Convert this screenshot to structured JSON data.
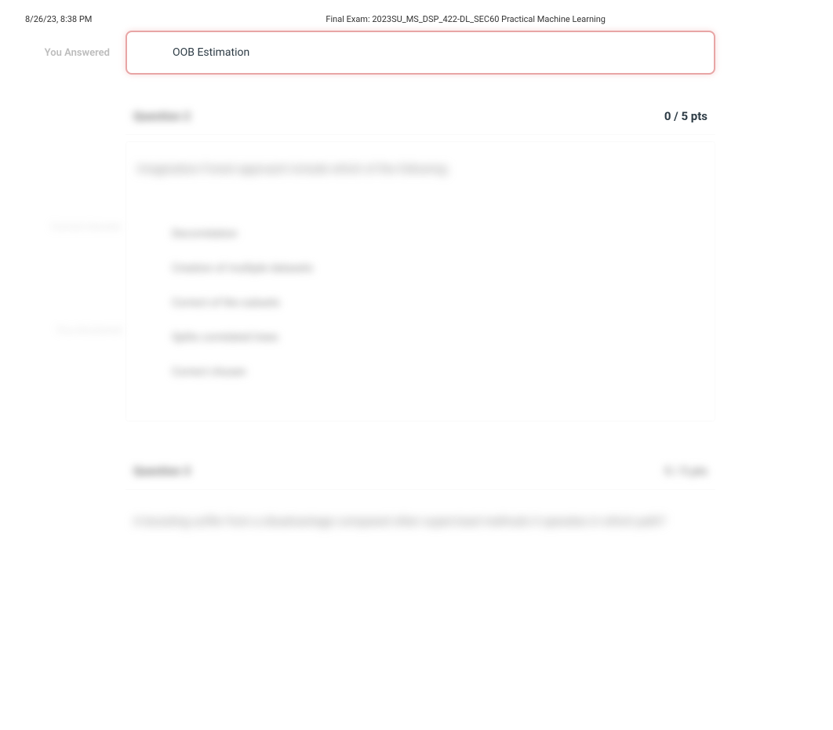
{
  "header": {
    "timestamp": "8/26/23, 8:38 PM",
    "title": "Final Exam: 2023SU_MS_DSP_422-DL_SEC60 Practical Machine Learning"
  },
  "q1_tail": {
    "you_answered_label": "You Answered",
    "answer_text": "OOB Estimation"
  },
  "q2": {
    "question_label": "Question 2",
    "pts": "0 / 5 pts",
    "prompt": "Imagination Forest approach include which of the following:",
    "correct_answer_label": "Correct Answer",
    "you_answered_label": "You Answered",
    "options": [
      "Decorrelation",
      "Creation of multiple datasets",
      "Correct of the subsets",
      "Splits correlated trees",
      "Correct chosen"
    ]
  },
  "q3": {
    "question_label": "Question 3",
    "pts": "5 / 5 pts",
    "prompt": "A boosting suffer from a disadvantage compared other supervised methods it operates in which path?"
  }
}
